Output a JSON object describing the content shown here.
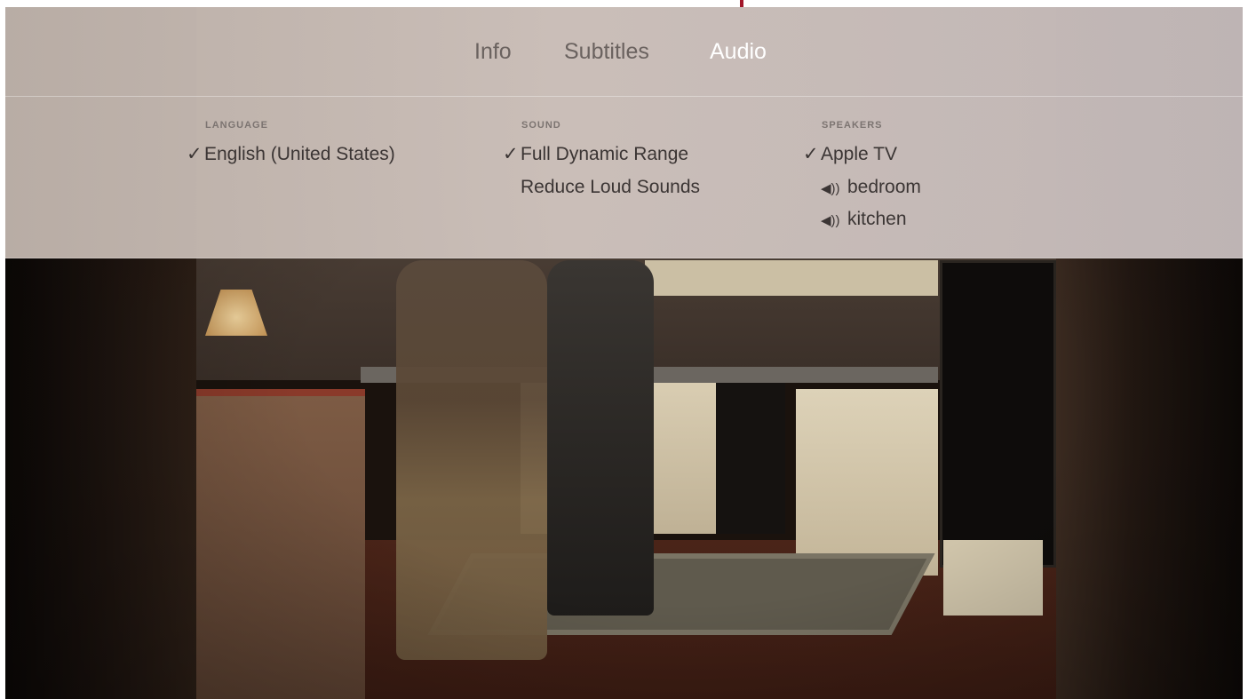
{
  "tabs": [
    {
      "label": "Info",
      "active": false
    },
    {
      "label": "Subtitles",
      "active": false
    },
    {
      "label": "Audio",
      "active": true
    }
  ],
  "columns": {
    "language": {
      "heading": "LANGUAGE",
      "items": [
        {
          "label": "English (United States)",
          "selected": true,
          "check": "✓"
        }
      ]
    },
    "sound": {
      "heading": "SOUND",
      "items": [
        {
          "label": "Full Dynamic Range",
          "selected": true,
          "check": "✓"
        },
        {
          "label": "Reduce Loud Sounds",
          "selected": false,
          "check": ""
        }
      ]
    },
    "speakers": {
      "heading": "SPEAKERS",
      "items": [
        {
          "label": "Apple TV",
          "selected": true,
          "check": "✓",
          "icon": ""
        },
        {
          "label": "bedroom",
          "selected": false,
          "check": "",
          "icon": "speaker-icon"
        },
        {
          "label": "kitchen",
          "selected": false,
          "check": "",
          "icon": "speaker-icon"
        }
      ]
    }
  },
  "colors": {
    "active_tab": "#ffffff",
    "inactive_tab": "#6a625f",
    "pointer": "#a2162a"
  }
}
